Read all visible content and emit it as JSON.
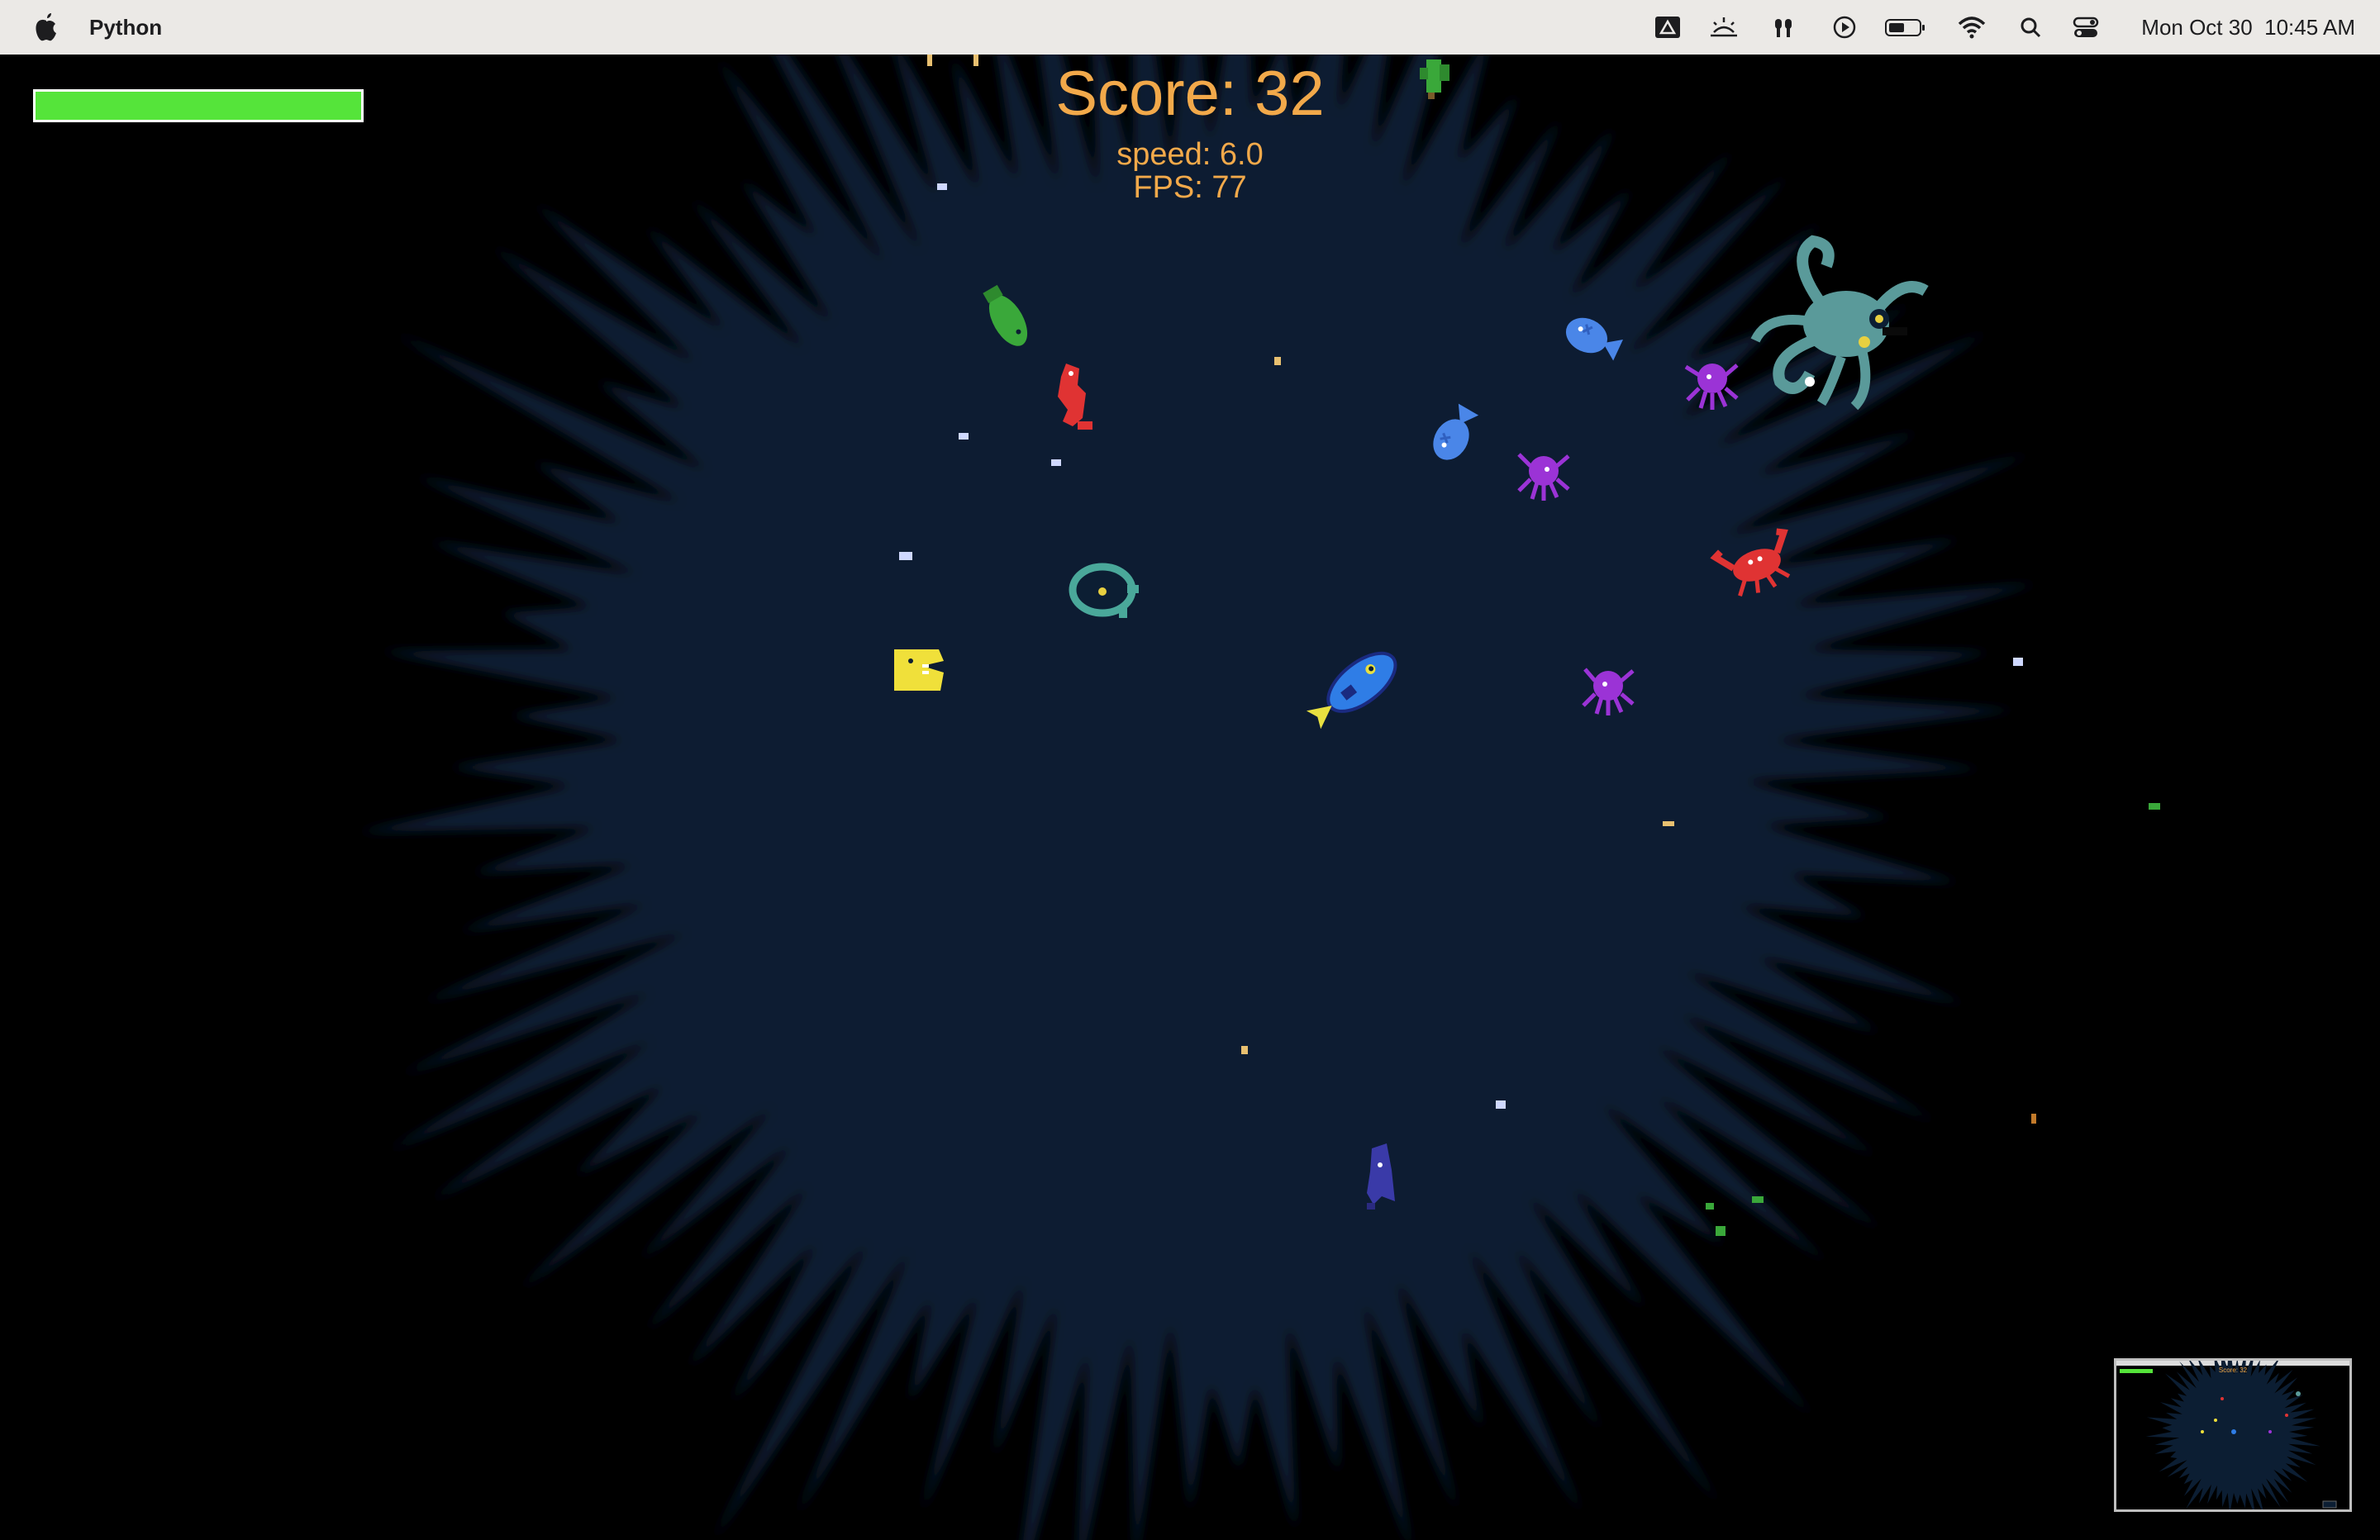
{
  "menubar": {
    "app_name": "Python",
    "date": "Mon Oct 30",
    "time": "10:45 AM",
    "icons": [
      "apple-icon",
      "drive-icon",
      "sunrise-icon",
      "airdrop-icon",
      "play-icon",
      "battery-icon",
      "wifi-icon",
      "search-icon",
      "control-center-icon"
    ]
  },
  "hud": {
    "score_label": "Score: 32",
    "speed_label": "speed: 6.0",
    "fps_label": "FPS: 77",
    "health_fraction": 1.0,
    "health_color": "#55e43a"
  },
  "minimap": {
    "score_label": "Score: 32"
  },
  "colors": {
    "ocean": "#0c1e33",
    "text": "#f2a94a",
    "player": "#2f7de6",
    "enemy_red": "#e03333",
    "enemy_purple": "#9b33d6",
    "enemy_blue": "#4a86e8",
    "enemy_green": "#3aa83a",
    "enemy_yellow": "#f0e03a",
    "boss_teal": "#5a9a9a"
  },
  "entities": [
    {
      "name": "player-fish",
      "sprite": "blue-fish"
    },
    {
      "name": "octopus-boss",
      "sprite": "teal-octopus"
    },
    {
      "name": "red-crab",
      "sprite": "crab"
    },
    {
      "name": "red-seahorse",
      "sprite": "seahorse"
    },
    {
      "name": "green-fish",
      "sprite": "fish"
    },
    {
      "name": "yellow-chomper",
      "sprite": "chomper"
    },
    {
      "name": "teal-turtle",
      "sprite": "turtle"
    },
    {
      "name": "blue-fish-a",
      "sprite": "fish"
    },
    {
      "name": "blue-fish-b",
      "sprite": "fish"
    },
    {
      "name": "purple-octopus-a",
      "sprite": "octopus"
    },
    {
      "name": "purple-octopus-b",
      "sprite": "octopus"
    },
    {
      "name": "purple-octopus-c",
      "sprite": "octopus"
    },
    {
      "name": "blue-squid",
      "sprite": "squid"
    }
  ]
}
